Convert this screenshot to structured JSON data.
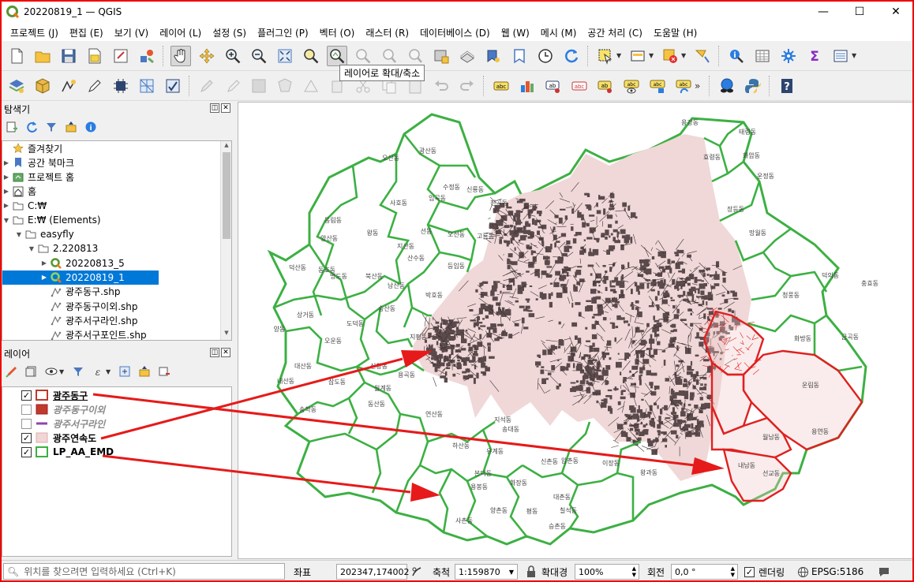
{
  "window": {
    "title": "20220819_1 — QGIS",
    "controls": {
      "minimize": "—",
      "maximize": "☐",
      "close": "✕"
    }
  },
  "menu": [
    "프로젝트 (J)",
    "편집 (E)",
    "보기 (V)",
    "레이어 (L)",
    "설정 (S)",
    "플러그인 (P)",
    "벡터 (O)",
    "래스터 (R)",
    "데이터베이스 (D)",
    "웹 (W)",
    "메시 (M)",
    "공간 처리 (C)",
    "도움말 (H)"
  ],
  "tooltip": "레이어로 확대/축소",
  "browser_panel": {
    "title": "탐색기",
    "items": [
      {
        "label": "즐겨찾기",
        "icon": "star-icon"
      },
      {
        "label": "공간 북마크",
        "icon": "bookmark-icon"
      },
      {
        "label": "프로젝트 홈",
        "icon": "project-home-icon"
      },
      {
        "label": "홈",
        "icon": "home-icon"
      },
      {
        "label": "C:₩",
        "icon": "drive-icon"
      },
      {
        "label": "E:₩ (Elements)",
        "icon": "drive-icon"
      },
      {
        "label": "easyfly",
        "icon": "folder-icon"
      },
      {
        "label": "2.220813",
        "icon": "folder-icon"
      },
      {
        "label": "20220813_5",
        "icon": "qgis-project-icon"
      },
      {
        "label": "20220819_1",
        "icon": "qgis-project-icon"
      },
      {
        "label": "광주동구.shp",
        "icon": "shapefile-icon"
      },
      {
        "label": "광주동구이외.shp",
        "icon": "shapefile-icon"
      },
      {
        "label": "광주서구라인.shp",
        "icon": "shapefile-icon"
      },
      {
        "label": "광주서구포인트.shp",
        "icon": "shapefile-icon"
      }
    ]
  },
  "layers_panel": {
    "title": "레이어",
    "layers": [
      {
        "name": "광주동구",
        "checked": "✓",
        "color": "#c0392b"
      },
      {
        "name": "광주동구이외",
        "checked": "",
        "color": "#c0392b"
      },
      {
        "name": "광주서구라인",
        "checked": "",
        "color": "#8e44ad"
      },
      {
        "name": "광주연속도",
        "checked": "✓",
        "color": "#f2d5d5"
      },
      {
        "name": "LP_AA_EMD",
        "checked": "✓",
        "color": "#3cb043"
      }
    ]
  },
  "statusbar": {
    "locator_placeholder": "위치를 찾으려면 입력하세요 (Ctrl+K)",
    "coord_label": "좌표",
    "coord_value": "202347,174002",
    "scale_label": "축척",
    "scale_value": "1:159870",
    "magnifier_label": "확대경",
    "magnifier_value": "100%",
    "rotation_label": "회전",
    "rotation_value": "0,0 °",
    "render_label": "렌더링",
    "render_checked": "✓",
    "crs": "EPSG:5186"
  },
  "map_labels": [
    "용강동",
    "태령동",
    "화암동",
    "효령동",
    "운정동",
    "광산동",
    "오산동",
    "수정동",
    "신룡동",
    "진곡동",
    "장등동",
    "사호동",
    "임곡동",
    "동림동",
    "양산동",
    "왕동",
    "선동",
    "오선동",
    "고룡동",
    "망월동",
    "지산동",
    "산수동",
    "등임동",
    "덕산동",
    "동호동",
    "명도동",
    "북산동",
    "남산동",
    "덕의동",
    "충효동",
    "청풍동",
    "박호동",
    "상거동",
    "송산동",
    "도덕동",
    "지평동",
    "양동",
    "오운동",
    "화방동",
    "금곡동",
    "대산동",
    "신창동",
    "삼도동",
    "내산동",
    "월계동",
    "용곡동",
    "송학동",
    "동산동",
    "연산동",
    "운림동",
    "용연동",
    "송대동",
    "하산동",
    "유계동",
    "월남동",
    "본덕동",
    "지석동",
    "압촌동",
    "이장동",
    "왕과동",
    "내남동",
    "선교동",
    "용봉동",
    "화장동",
    "대촌동",
    "칠석동",
    "신촌동",
    "평동",
    "양촌동",
    "승촌동",
    "사촌동"
  ],
  "colors": {
    "boundary_green": "#3cb043",
    "donggu_red": "#e02020",
    "urban_fill": "#5b4a4c",
    "arrow_red": "#e61a1a"
  }
}
